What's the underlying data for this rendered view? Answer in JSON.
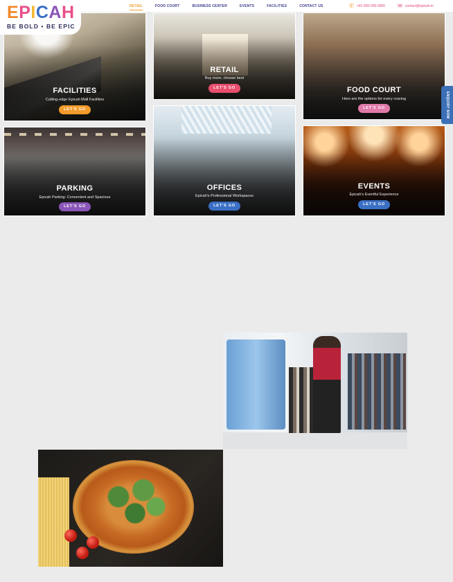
{
  "logo": {
    "letters": [
      {
        "ch": "E",
        "color": "#f08a2b"
      },
      {
        "ch": "P",
        "color": "#e94e8a"
      },
      {
        "ch": "I",
        "color": "#f2b830"
      },
      {
        "ch": "C",
        "color": "#3a6fc4"
      },
      {
        "ch": "A",
        "color": "#8a55b8"
      },
      {
        "ch": "H",
        "color": "#e94e8a"
      }
    ],
    "tagline": "BE BOLD • BE EPIC"
  },
  "nav": {
    "items": [
      "RETAIL",
      "FOOD COURT",
      "BUSINESS CENTER",
      "EVENTS",
      "FACILITIES",
      "CONTACT US"
    ],
    "active_index": 0,
    "active_color": "#f29b2a"
  },
  "contact": {
    "phone_icon": "phone-icon",
    "phone": "+91-000-000-0000",
    "mail_icon": "mail-icon",
    "email": "contact@epicah.in"
  },
  "cards": {
    "facilities": {
      "title": "FACILITIES",
      "subtitle": "Cutting-edge Epicah Mall Facilities",
      "button": "LET'S GO",
      "button_color": "#f29b2a"
    },
    "retail": {
      "title": "RETAIL",
      "subtitle": "Buy more, choose best",
      "button": "LET'S GO",
      "button_color": "#e94e6e"
    },
    "food_court": {
      "title": "FOOD COURT",
      "subtitle": "Here are the options for every craving",
      "button": "LET'S GO",
      "button_color": "#e07aa8"
    },
    "parking": {
      "title": "PARKING",
      "subtitle": "Epicah Parking: Convenient and Spacious",
      "button": "LET'S GO",
      "button_color": "#8a55b8"
    },
    "offices": {
      "title": "OFFICES",
      "subtitle": "Epicah's Professional Workspaces",
      "button": "LET'S GO",
      "button_color": "#3a6fc4"
    },
    "events": {
      "title": "EVENTS",
      "subtitle": "Epicah's Eventful Experience",
      "button": "LET'S GO",
      "button_color": "#3a6fc4"
    }
  },
  "enquiry": {
    "label": "ENQUIRY NOW",
    "color": "#3b6fb6"
  }
}
